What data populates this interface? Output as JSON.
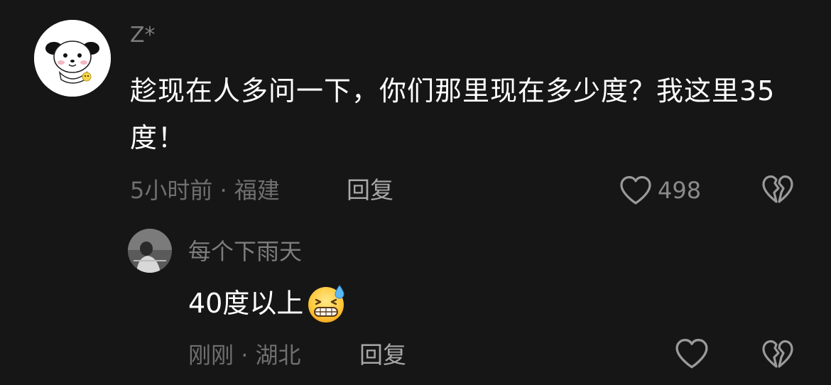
{
  "comments": [
    {
      "username": "Z*",
      "text": "趁现在人多问一下，你们那里现在多少度？我这里35度！",
      "time": "5小时前",
      "separator": " · ",
      "location": "福建",
      "reply_label": "回复",
      "like_count": "498",
      "icons": {
        "avatar": "cartoon-dog-avatar",
        "like": "heart-outline-icon",
        "dislike": "broken-heart-icon"
      }
    },
    {
      "username": "每个下雨天",
      "text": "40度以上",
      "emoji": "grinning-sweat-emoji",
      "time": "刚刚",
      "separator": " · ",
      "location": "湖北",
      "reply_label": "回复",
      "icons": {
        "avatar": "photo-avatar",
        "like": "heart-outline-icon",
        "dislike": "broken-heart-icon"
      }
    }
  ],
  "colors": {
    "background": "#161616",
    "text_primary": "#ffffff",
    "text_secondary": "#7d7d7d",
    "icon": "#9a9a9a"
  }
}
